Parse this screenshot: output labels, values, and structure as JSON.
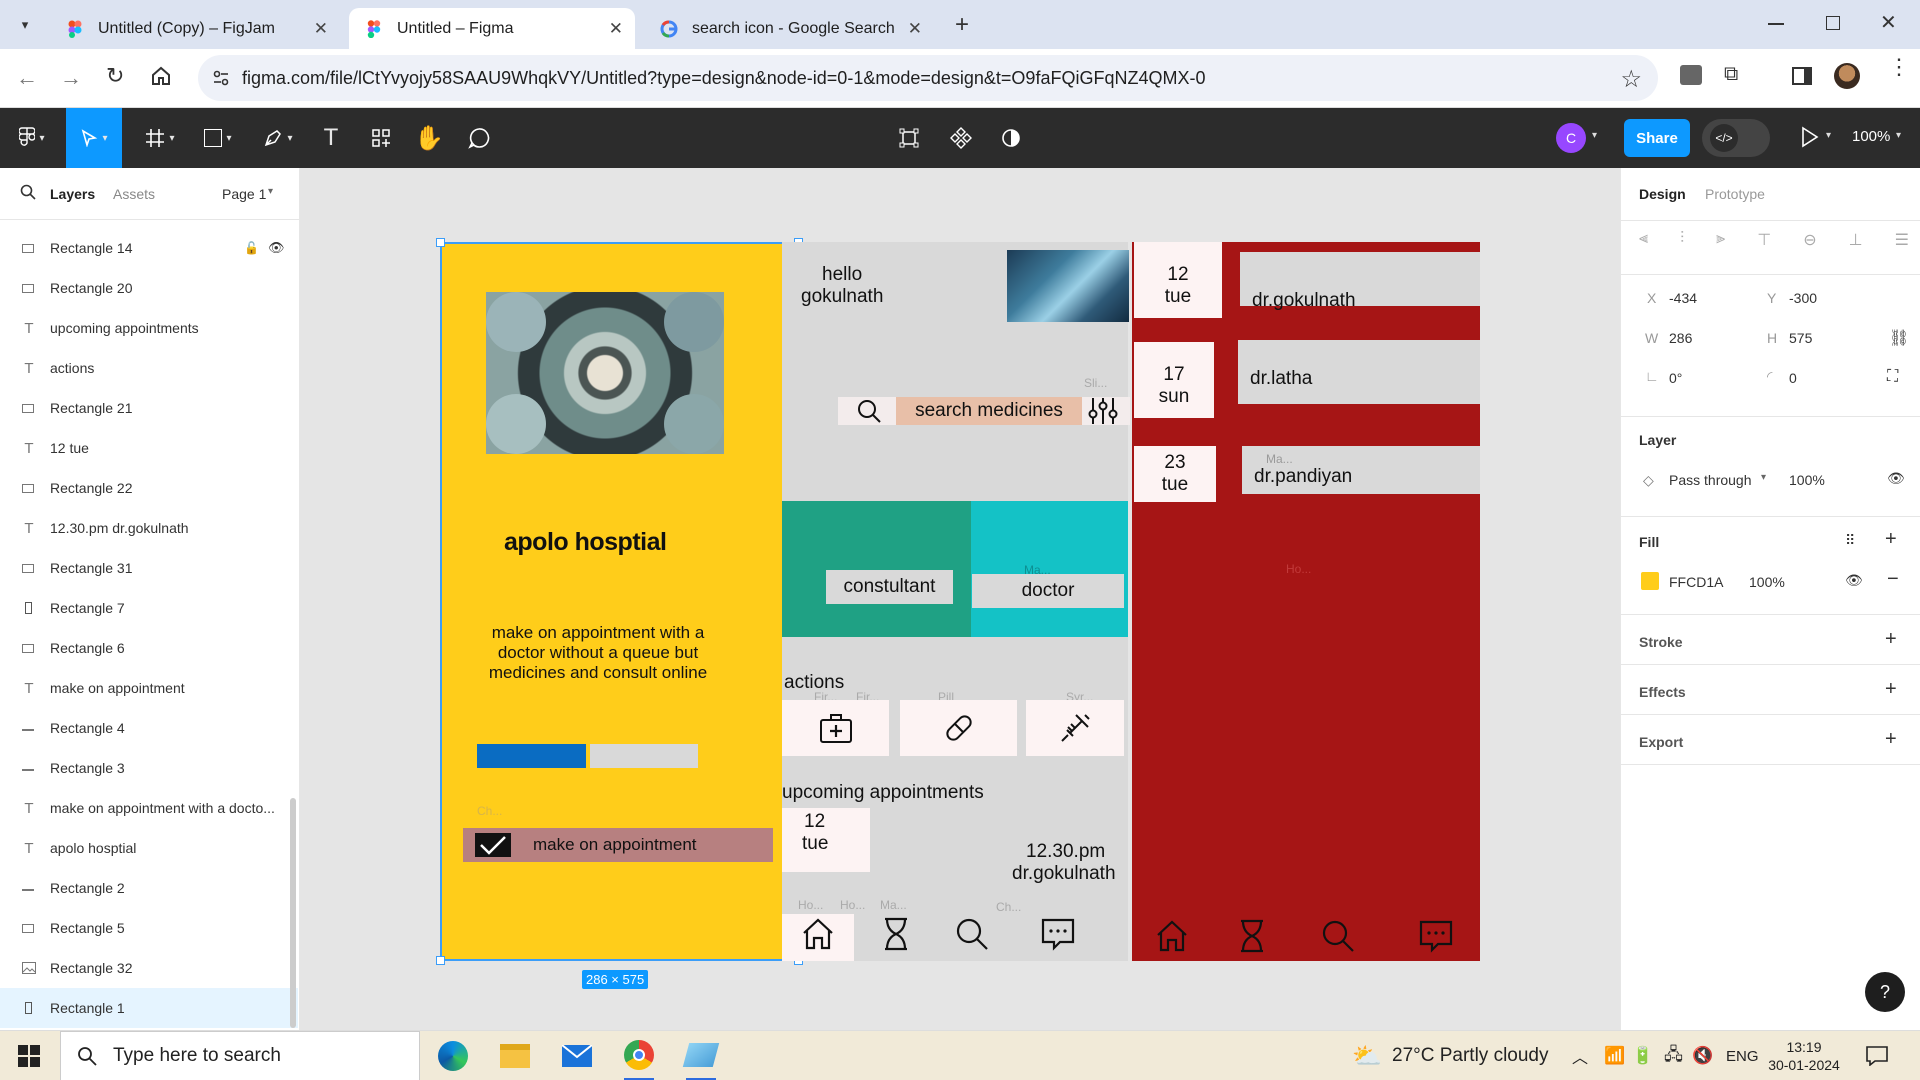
{
  "browser": {
    "tabs": [
      {
        "title": "Untitled (Copy) – FigJam",
        "favicon": "figjam-icon"
      },
      {
        "title": "Untitled – Figma",
        "favicon": "figma-icon",
        "active": true
      },
      {
        "title": "search icon - Google Search",
        "favicon": "google-icon"
      }
    ],
    "url": "figma.com/file/lCtYvyojy58SAAU9WhqkVY/Untitled?type=design&node-id=0-1&mode=design&t=O9faFQiGFqNZ4QMX-0"
  },
  "figma_toolbar": {
    "avatar_letter": "C",
    "share_label": "Share",
    "zoom": "100%"
  },
  "left_panel": {
    "tabs": [
      "Layers",
      "Assets"
    ],
    "page": "Page 1",
    "layers": [
      {
        "name": "Rectangle 14",
        "icon": "rectangle-icon"
      },
      {
        "name": "Rectangle 20",
        "icon": "rectangle-icon"
      },
      {
        "name": "upcoming appointments",
        "icon": "text-icon"
      },
      {
        "name": "actions",
        "icon": "text-icon"
      },
      {
        "name": "Rectangle 21",
        "icon": "rectangle-icon"
      },
      {
        "name": "12 tue",
        "icon": "text-icon"
      },
      {
        "name": "Rectangle 22",
        "icon": "rectangle-icon"
      },
      {
        "name": "12.30.pm dr.gokulnath",
        "icon": "text-icon"
      },
      {
        "name": "Rectangle 31",
        "icon": "rectangle-icon"
      },
      {
        "name": "Rectangle 7",
        "icon": "rectangle-tall-icon"
      },
      {
        "name": "Rectangle 6",
        "icon": "rectangle-icon"
      },
      {
        "name": "make on appointment",
        "icon": "text-icon"
      },
      {
        "name": "Rectangle 4",
        "icon": "line-icon"
      },
      {
        "name": "Rectangle 3",
        "icon": "line-icon"
      },
      {
        "name": "make on appointment with a docto...",
        "icon": "text-icon"
      },
      {
        "name": "apolo hosptial",
        "icon": "text-icon"
      },
      {
        "name": "Rectangle 2",
        "icon": "line-icon"
      },
      {
        "name": "Rectangle 5",
        "icon": "rectangle-icon"
      },
      {
        "name": "Rectangle 32",
        "icon": "image-icon"
      },
      {
        "name": "Rectangle 1",
        "icon": "rectangle-tall-icon",
        "selected": true
      }
    ]
  },
  "canvas": {
    "selection_size": "286 × 575",
    "frame1": {
      "title": "apolo hosptial",
      "description": "make on  appointment with a doctor without a queue but medicines and consult online",
      "ghost_label": "Ch...",
      "button": "make on appointment"
    },
    "frame2": {
      "greeting_line1": "hello",
      "greeting_line2": "gokulnath",
      "ghost_sli": "Sli...",
      "search": "search medicines",
      "consultant": "constultant",
      "doctor": "doctor",
      "ghost_ma": "Ma...",
      "actions_title": "actions",
      "ghost_fir1": "Fir...",
      "ghost_fir2": "Fir...",
      "ghost_pill": "Pill",
      "ghost_syr": "Syr...",
      "upcoming_title": "upcoming appointments",
      "upcoming_date_line1": "12",
      "upcoming_date_line2": "tue",
      "upcoming_time": "12.30.pm",
      "upcoming_doctor": "dr.gokulnath",
      "ghost_ho1": "Ho...",
      "ghost_ho2": "Ho...",
      "ghost_ma2": "Ma...",
      "ghost_ch": "Ch..."
    },
    "frame3": {
      "appointments": [
        {
          "day": "12",
          "dow": "tue",
          "doctor": "dr.gokulnath"
        },
        {
          "day": "17",
          "dow": "sun",
          "doctor": "dr.latha"
        },
        {
          "day": "23",
          "dow": "tue",
          "doctor": "dr.pandiyan"
        }
      ],
      "ghost_ma": "Ma...",
      "ghost_ho": "Ho..."
    },
    "colors": {
      "yellow": "#FFCD1A",
      "green": "#1FA184",
      "cyan": "#14C2C6",
      "red": "#A61515",
      "grey": "#D9D9D9",
      "pink": "#B78080",
      "blue": "#0A6CC2",
      "tan": "#E8BFA8"
    }
  },
  "right_panel": {
    "tabs": [
      "Design",
      "Prototype"
    ],
    "x_label": "X",
    "x": "-434",
    "y_label": "Y",
    "y": "-300",
    "w_label": "W",
    "w": "286",
    "h_label": "H",
    "h": "575",
    "rotation": "0°",
    "radius": "0",
    "layer_title": "Layer",
    "blend": "Pass through",
    "layer_opacity": "100%",
    "fill_title": "Fill",
    "fill_hex": "FFCD1A",
    "fill_opacity": "100%",
    "stroke": "Stroke",
    "effects": "Effects",
    "export": "Export",
    "help": "?"
  },
  "taskbar": {
    "search_placeholder": "Type here to search",
    "weather": "27°C  Partly cloudy",
    "lang": "ENG",
    "time": "13:19",
    "date": "30-01-2024"
  }
}
